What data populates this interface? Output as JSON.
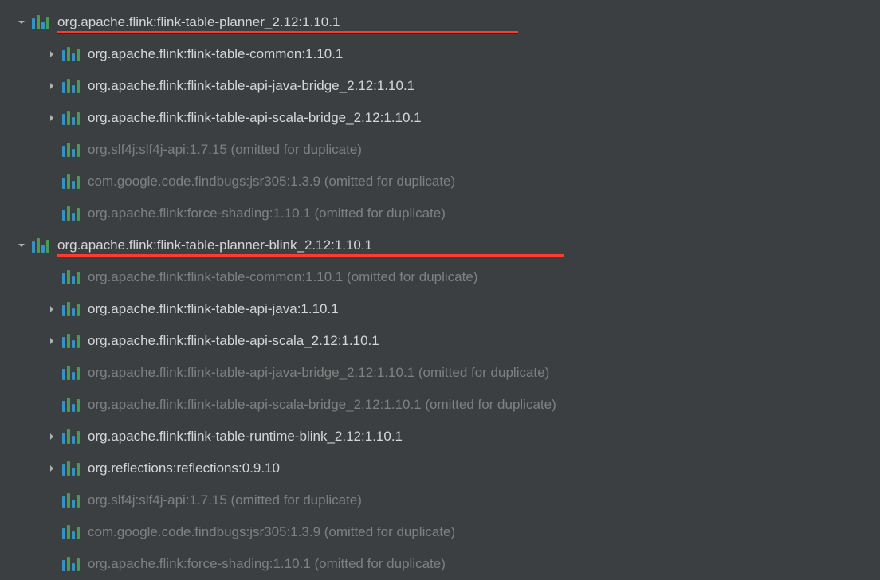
{
  "tree": [
    {
      "indent": 0,
      "expander": "down",
      "dim": false,
      "underline": true,
      "underlineWidth": 578,
      "label": "org.apache.flink:flink-table-planner_2.12:1.10.1"
    },
    {
      "indent": 1,
      "expander": "right",
      "dim": false,
      "label": "org.apache.flink:flink-table-common:1.10.1"
    },
    {
      "indent": 1,
      "expander": "right",
      "dim": false,
      "label": "org.apache.flink:flink-table-api-java-bridge_2.12:1.10.1"
    },
    {
      "indent": 1,
      "expander": "right",
      "dim": false,
      "label": "org.apache.flink:flink-table-api-scala-bridge_2.12:1.10.1"
    },
    {
      "indent": 1,
      "expander": "none",
      "dim": true,
      "label": "org.slf4j:slf4j-api:1.7.15 (omitted for duplicate)"
    },
    {
      "indent": 1,
      "expander": "none",
      "dim": true,
      "label": "com.google.code.findbugs:jsr305:1.3.9 (omitted for duplicate)"
    },
    {
      "indent": 1,
      "expander": "none",
      "dim": true,
      "label": "org.apache.flink:force-shading:1.10.1 (omitted for duplicate)"
    },
    {
      "indent": 0,
      "expander": "down",
      "dim": false,
      "underline": true,
      "underlineWidth": 636,
      "label": "org.apache.flink:flink-table-planner-blink_2.12:1.10.1"
    },
    {
      "indent": 1,
      "expander": "none",
      "dim": true,
      "label": "org.apache.flink:flink-table-common:1.10.1 (omitted for duplicate)"
    },
    {
      "indent": 1,
      "expander": "right",
      "dim": false,
      "label": "org.apache.flink:flink-table-api-java:1.10.1"
    },
    {
      "indent": 1,
      "expander": "right",
      "dim": false,
      "label": "org.apache.flink:flink-table-api-scala_2.12:1.10.1"
    },
    {
      "indent": 1,
      "expander": "none",
      "dim": true,
      "label": "org.apache.flink:flink-table-api-java-bridge_2.12:1.10.1 (omitted for duplicate)"
    },
    {
      "indent": 1,
      "expander": "none",
      "dim": true,
      "label": "org.apache.flink:flink-table-api-scala-bridge_2.12:1.10.1 (omitted for duplicate)"
    },
    {
      "indent": 1,
      "expander": "right",
      "dim": false,
      "label": "org.apache.flink:flink-table-runtime-blink_2.12:1.10.1"
    },
    {
      "indent": 1,
      "expander": "right",
      "dim": false,
      "label": "org.reflections:reflections:0.9.10"
    },
    {
      "indent": 1,
      "expander": "none",
      "dim": true,
      "label": "org.slf4j:slf4j-api:1.7.15 (omitted for duplicate)"
    },
    {
      "indent": 1,
      "expander": "none",
      "dim": true,
      "label": "com.google.code.findbugs:jsr305:1.3.9 (omitted for duplicate)"
    },
    {
      "indent": 1,
      "expander": "none",
      "dim": true,
      "label": "org.apache.flink:force-shading:1.10.1 (omitted for duplicate)"
    }
  ]
}
